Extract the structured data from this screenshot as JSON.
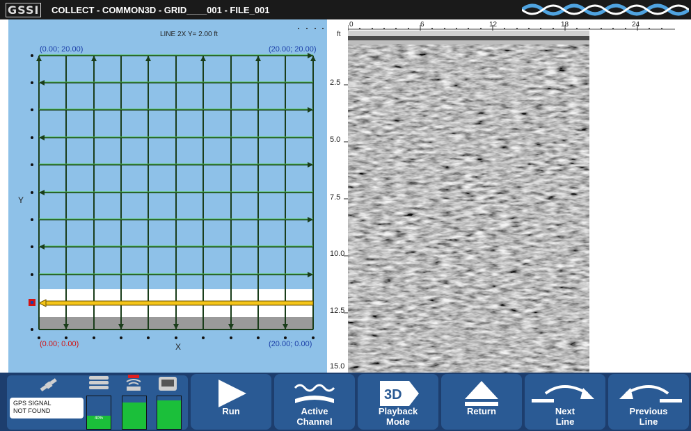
{
  "header": {
    "brand": "GSSI",
    "title": "COLLECT - COMMON3D - GRID____001 - FILE_001"
  },
  "grid_panel": {
    "line_label": "LINE 2X  Y= 2.00 ft",
    "coord_top_left": "(0.00; 20.00)",
    "coord_top_right": "(20.00; 20.00)",
    "coord_bottom_left": "(0.00; 0.00)",
    "coord_bottom_right": "(20.00; 0.00)",
    "x_label": "X",
    "y_label": "Y",
    "colors": {
      "background": "#8ec1e8",
      "grid": "#1a5c1a",
      "active_line": "#f5c518",
      "marker": "#d21414"
    }
  },
  "scan_panel": {
    "depth_unit": "ft",
    "depth_ticks": [
      "2.5",
      "5.0",
      "7.5",
      "10.0",
      "12.5",
      "15.0"
    ],
    "x_ticks": [
      "0",
      "6",
      "12",
      "18",
      "24"
    ]
  },
  "status": {
    "gps_text_line1": "GPS SIGNAL",
    "gps_text_line2": "NOT FOUND",
    "storage_level": 0.4,
    "storage_text": "40%",
    "signal_level": 0.8,
    "battery_level": 0.88
  },
  "buttons": {
    "run": "Run",
    "active_channel_1": "Active",
    "active_channel_2": "Channel",
    "playback_1": "Playback",
    "playback_2": "Mode",
    "return": "Return",
    "next_1": "Next",
    "next_2": "Line",
    "previous_1": "Previous",
    "previous_2": "Line"
  }
}
